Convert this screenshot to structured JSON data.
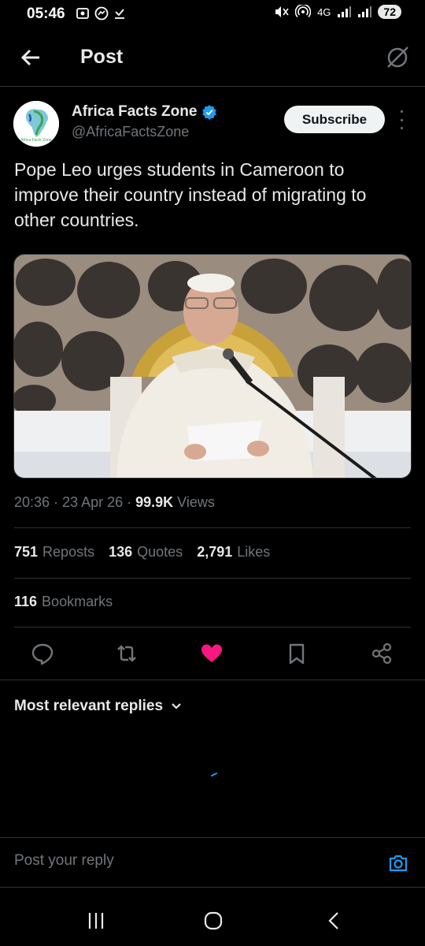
{
  "status_bar": {
    "time": "05:46",
    "network": "4G",
    "battery": "72",
    "icons": [
      "screenshot-icon",
      "messenger-icon",
      "download-icon",
      "mute-icon",
      "hotspot-icon",
      "signal-icon",
      "signal-icon"
    ]
  },
  "header": {
    "title": "Post",
    "icons": [
      "back-arrow-icon",
      "grok-icon"
    ]
  },
  "author": {
    "name": "Africa Facts Zone",
    "handle": "@AfricaFactsZone",
    "verified": true,
    "avatar_text": "Africa Facts Zone",
    "subscribe_label": "Subscribe"
  },
  "post": {
    "text": "Pope Leo urges students in Cameroon to improve their country instead of migrating to other countries.",
    "time": "20:36",
    "date": "23 Apr 26",
    "views_count": "99.9K",
    "views_label": "Views",
    "separator": " · "
  },
  "stats": {
    "reposts_count": "751",
    "reposts_label": "Reposts",
    "quotes_count": "136",
    "quotes_label": "Quotes",
    "likes_count": "2,791",
    "likes_label": "Likes",
    "bookmarks_count": "116",
    "bookmarks_label": "Bookmarks"
  },
  "actions": [
    "reply-icon",
    "repost-icon",
    "like-icon",
    "bookmark-icon",
    "share-icon"
  ],
  "colors": {
    "background": "#000000",
    "text": "#e7e9ea",
    "secondary": "#71767b",
    "like": "#f91880",
    "accent": "#1d9bf0",
    "divider": "#2f3336"
  },
  "replies": {
    "sort_label": "Most relevant replies"
  },
  "reply_box": {
    "placeholder": "Post your reply"
  },
  "nav": [
    "recents-icon",
    "home-icon",
    "back-icon"
  ]
}
